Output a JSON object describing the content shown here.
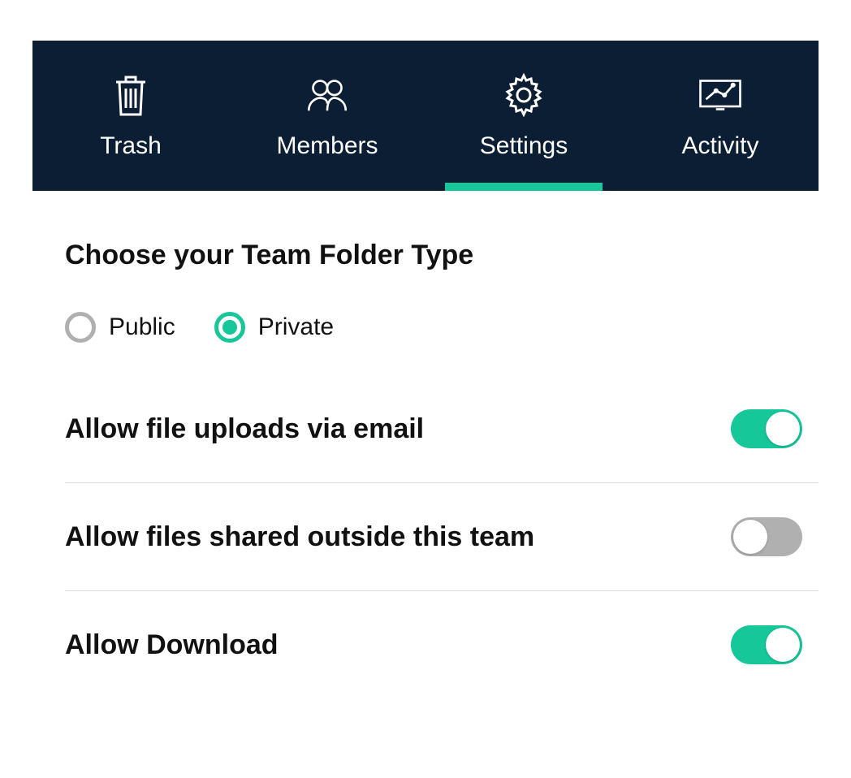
{
  "tabs": [
    {
      "label": "Trash"
    },
    {
      "label": "Members"
    },
    {
      "label": "Settings"
    },
    {
      "label": "Activity"
    }
  ],
  "active_tab_index": 2,
  "section_title": "Choose your Team Folder Type",
  "folder_type": {
    "options": [
      {
        "label": "Public",
        "selected": false
      },
      {
        "label": "Private",
        "selected": true
      }
    ]
  },
  "settings": [
    {
      "label": "Allow file uploads via email",
      "enabled": true
    },
    {
      "label": "Allow files shared outside this team",
      "enabled": false
    },
    {
      "label": "Allow Download",
      "enabled": true
    }
  ],
  "colors": {
    "accent": "#16c79a",
    "nav_bg": "#0b1e34"
  }
}
